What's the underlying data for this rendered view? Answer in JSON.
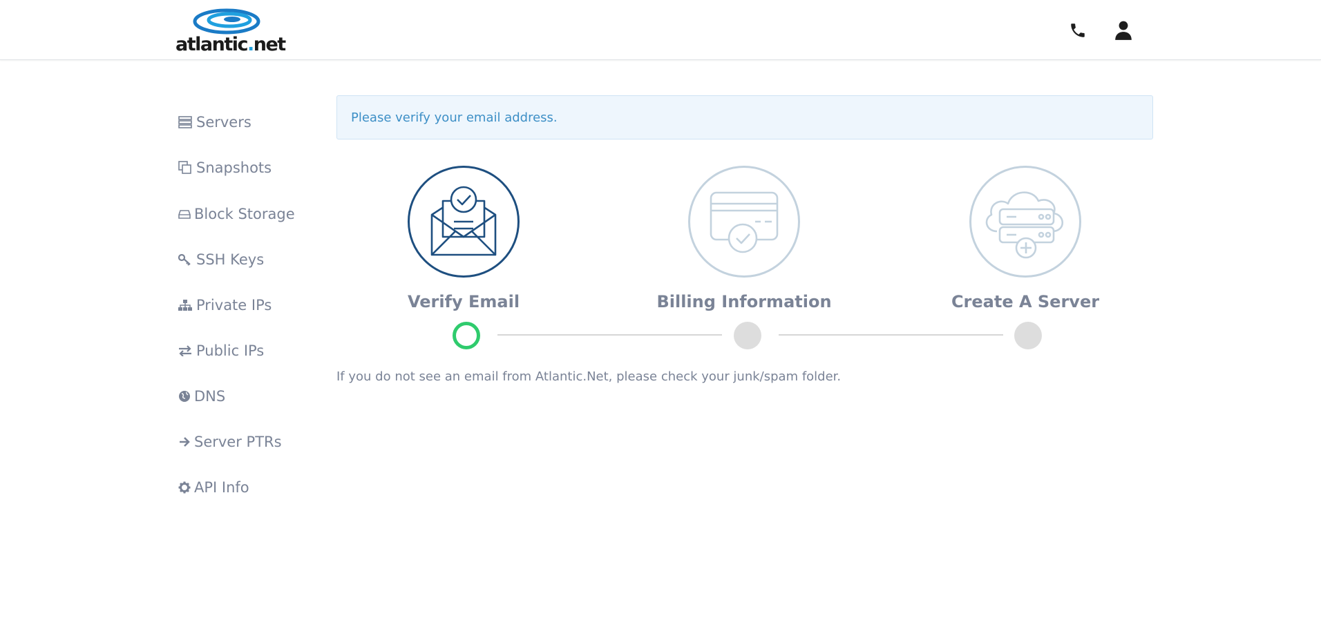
{
  "brand": {
    "logo_text_main": "atlantic",
    "logo_text_dot": ".",
    "logo_text_tail": "net",
    "accent": "#1fa0df"
  },
  "header": {
    "phone_icon": "phone-icon",
    "user_icon": "user-icon"
  },
  "sidebar": {
    "items": [
      {
        "label": "Servers",
        "icon": "server-icon"
      },
      {
        "label": "Snapshots",
        "icon": "copy-icon"
      },
      {
        "label": "Block Storage",
        "icon": "hard-drive-icon"
      },
      {
        "label": "SSH Keys",
        "icon": "key-icon"
      },
      {
        "label": "Private IPs",
        "icon": "network-icon"
      },
      {
        "label": "Public IPs",
        "icon": "exchange-icon"
      },
      {
        "label": "DNS",
        "icon": "globe-icon"
      },
      {
        "label": "Server PTRs",
        "icon": "arrow-right-icon"
      },
      {
        "label": "API Info",
        "icon": "gear-icon"
      }
    ]
  },
  "alert": {
    "message": "Please verify your email address.",
    "color": "#3d8fc6"
  },
  "steps": [
    {
      "label": "Verify Email",
      "icon": "envelope-check-icon",
      "status": "active"
    },
    {
      "label": "Billing Information",
      "icon": "credit-card-check-icon",
      "status": "pending"
    },
    {
      "label": "Create A Server",
      "icon": "cloud-server-add-icon",
      "status": "pending"
    }
  ],
  "progress": {
    "current_step": 1,
    "total_steps": 3,
    "done_color": "#2fcb6d",
    "todo_color": "#dddddd"
  },
  "note": "If you do not see an email from Atlantic.Net, please check your junk/spam folder."
}
